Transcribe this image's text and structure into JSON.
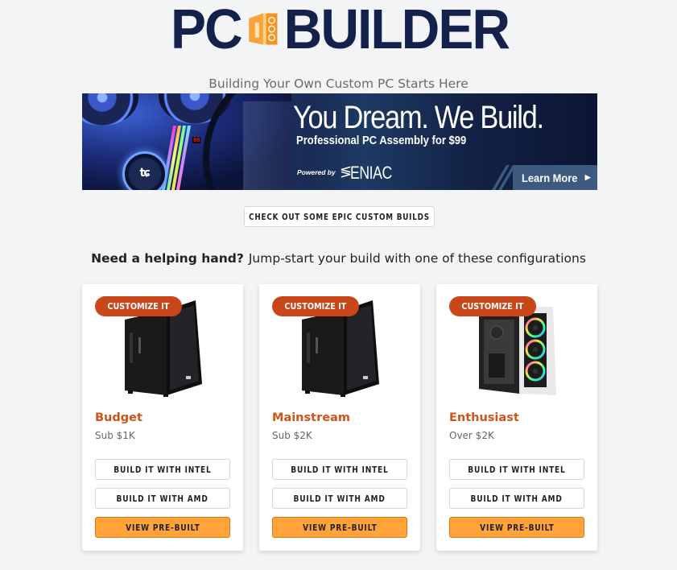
{
  "logo": {
    "left_text": "PC",
    "right_text": "BUILDER",
    "icon": "pc-case-icon",
    "colors": {
      "text": "#14214d",
      "icon": "#f6921e"
    }
  },
  "tagline": "Building Your Own Custom PC Starts Here",
  "banner": {
    "headline": "You Dream. We Build.",
    "subheadline": "Professional PC Assembly for $99",
    "powered_by": "Powered by",
    "partner": "ENIAC",
    "debug_code": "80",
    "cta_label": "Learn More",
    "cta_icon": "caret-right-icon"
  },
  "epic_builds_label": "CHECK OUT SOME EPIC CUSTOM BUILDS",
  "helper": {
    "bold": "Need a helping hand?",
    "rest": "Jump-start your build with one of these configurations"
  },
  "cards": [
    {
      "badge": "CUSTOMIZE IT",
      "title": "Budget",
      "subtitle": "Sub $1K",
      "intel_label": "BUILD IT WITH INTEL",
      "amd_label": "BUILD IT WITH AMD",
      "prebuilt_label": "VIEW PRE-BUILT"
    },
    {
      "badge": "CUSTOMIZE IT",
      "title": "Mainstream",
      "subtitle": "Sub $2K",
      "intel_label": "BUILD IT WITH INTEL",
      "amd_label": "BUILD IT WITH AMD",
      "prebuilt_label": "VIEW PRE-BUILT"
    },
    {
      "badge": "CUSTOMIZE IT",
      "title": "Enthusiast",
      "subtitle": "Over $2K",
      "intel_label": "BUILD IT WITH INTEL",
      "amd_label": "BUILD IT WITH AMD",
      "prebuilt_label": "VIEW PRE-BUILT"
    }
  ],
  "colors": {
    "accent_orange": "#ffa33a",
    "badge": "#c9461b",
    "title_orange": "#d0531a",
    "navy": "#14214d"
  }
}
